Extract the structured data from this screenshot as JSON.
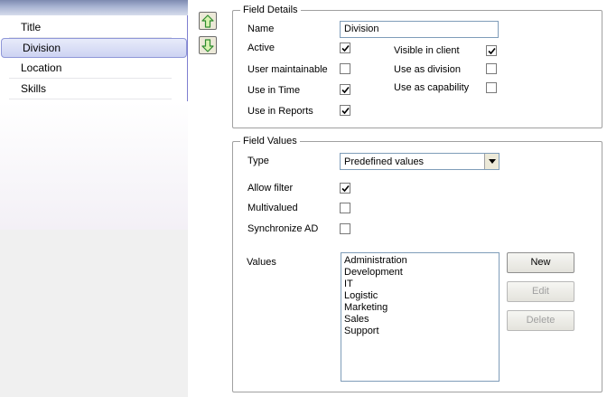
{
  "categories": {
    "items": [
      {
        "label": "Title",
        "selected": false
      },
      {
        "label": "Division",
        "selected": true
      },
      {
        "label": "Location",
        "selected": false
      },
      {
        "label": "Skills",
        "selected": false
      }
    ]
  },
  "move_buttons": {
    "up_icon": "arrow-up-icon",
    "down_icon": "arrow-down-icon",
    "color": "#2e8b2e"
  },
  "field_details": {
    "title": "Field Details",
    "name_label": "Name",
    "name_value": "Division",
    "active_label": "Active",
    "active_checked": true,
    "user_maintainable_label": "User maintainable",
    "user_maintainable_checked": false,
    "use_in_time_label": "Use in Time",
    "use_in_time_checked": true,
    "use_in_reports_label": "Use in Reports",
    "use_in_reports_checked": true,
    "visible_in_client_label": "Visible in client",
    "visible_in_client_checked": true,
    "use_as_division_label": "Use as division",
    "use_as_division_checked": false,
    "use_as_capability_label": "Use as capability",
    "use_as_capability_checked": false
  },
  "field_values": {
    "title": "Field Values",
    "type_label": "Type",
    "type_value": "Predefined values",
    "allow_filter_label": "Allow filter",
    "allow_filter_checked": true,
    "multivalued_label": "Multivalued",
    "multivalued_checked": false,
    "synchronize_ad_label": "Synchronize AD",
    "synchronize_ad_checked": false,
    "values_label": "Values",
    "values": [
      "Administration",
      "Development",
      "IT",
      "Logistic",
      "Marketing",
      "Sales",
      "Support"
    ],
    "new_label": "New",
    "edit_label": "Edit",
    "delete_label": "Delete"
  }
}
